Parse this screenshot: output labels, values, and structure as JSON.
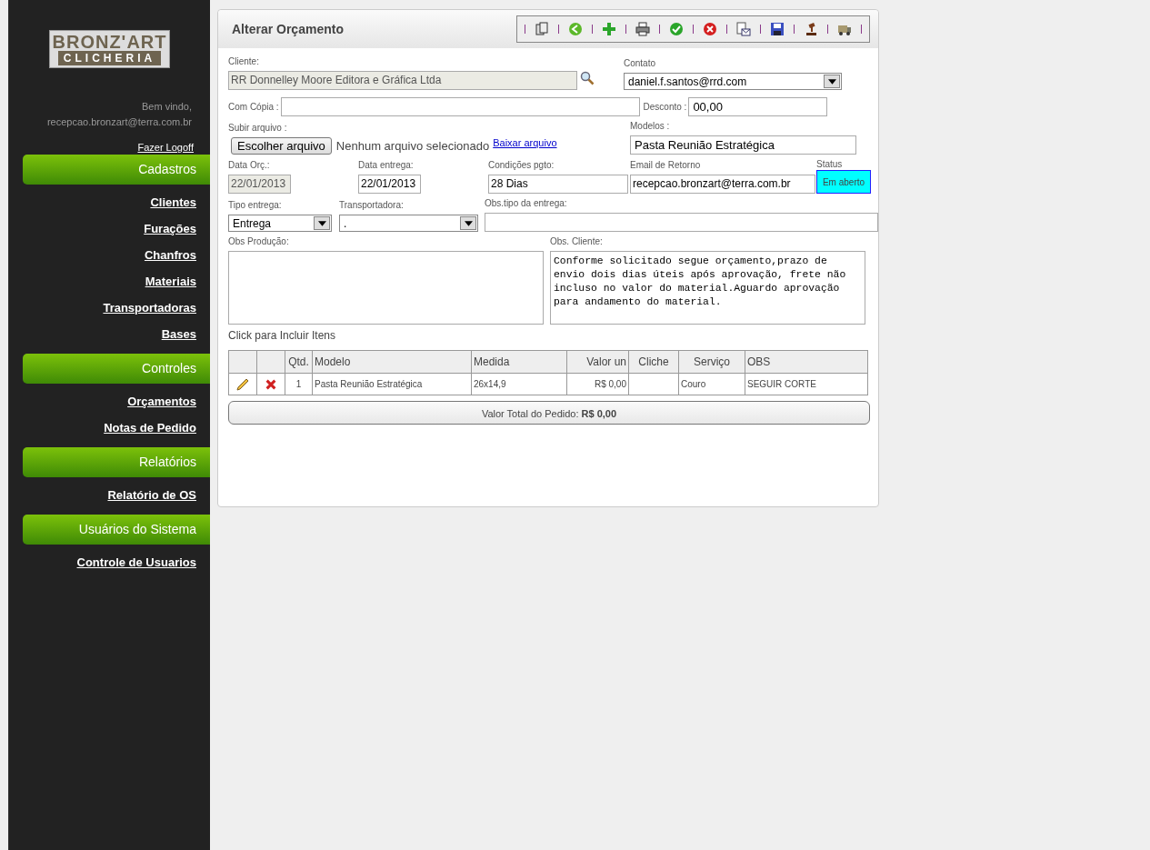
{
  "logo": {
    "line_1": "BRONZ'ART",
    "line_2": "CLICHERIA"
  },
  "welcome": {
    "greeting": "Bem vindo,",
    "user": "recepcao.bronzart@terra.com.br",
    "logoff": "Fazer Logoff"
  },
  "sidebar": [
    {
      "header": "Cadastros",
      "items": [
        "Clientes",
        "Furações",
        "Chanfros",
        "Materiais",
        "Transportadoras",
        "Bases"
      ]
    },
    {
      "header": "Controles",
      "items": [
        "Orçamentos",
        "Notas de Pedido"
      ]
    },
    {
      "header": "Relatórios",
      "items": [
        "Relatório de OS"
      ]
    },
    {
      "header": "Usuários do Sistema",
      "items": [
        "Controle de Usuarios"
      ]
    }
  ],
  "panel": {
    "title": "Alterar Orçamento"
  },
  "form": {
    "cliente": {
      "label": "Cliente:",
      "value": "RR Donnelley Moore Editora e Gráfica Ltda"
    },
    "contato": {
      "label": "Contato",
      "value": "daniel.f.santos@rrd.com"
    },
    "com_copia": {
      "label": "Com Cópia :"
    },
    "desconto": {
      "label": "Desconto :",
      "value": "00,00"
    },
    "subir_arquivo": {
      "label": "Subir arquivo :",
      "button": "Escolher arquivo",
      "status": "Nenhum arquivo selecionado",
      "link": "Baixar arquivo"
    },
    "modelos": {
      "label": "Modelos :",
      "value": "Pasta Reunião Estratégica"
    },
    "data_orc": {
      "label": "Data Orç.:",
      "value": "22/01/2013"
    },
    "data_entrega": {
      "label": "Data entrega:",
      "value": "22/01/2013"
    },
    "condicoes": {
      "label": "Condições pgto:",
      "value": "28 Dias"
    },
    "email_retorno": {
      "label": "Email de Retorno",
      "value": "recepcao.bronzart@terra.com.br"
    },
    "status": {
      "label": "Status",
      "value": "Em aberto"
    },
    "tipo_entrega": {
      "label": "Tipo entrega:",
      "value": "Entrega"
    },
    "transportadora": {
      "label": "Transportadora:",
      "value": "."
    },
    "obs_tipo": {
      "label": "Obs.tipo da entrega:"
    },
    "obs_producao": {
      "label": "Obs Produção:"
    },
    "obs_cliente": {
      "label": "Obs. Cliente:",
      "value": "Conforme solicitado segue orçamento,prazo de envio dois dias úteis após aprovação, frete não incluso no valor do material.Aguardo aprovação para andamento do material."
    }
  },
  "include_items": "Click para Incluir Itens",
  "table": {
    "columns": [
      "Qtd.",
      "Modelo",
      "Medida",
      "Valor un",
      "Cliche",
      "Serviço",
      "OBS"
    ],
    "rows": [
      {
        "cells": [
          "1",
          "Pasta Reunião Estratégica",
          "26x14,9",
          "R$ 0,00",
          "",
          "Couro",
          "SEGUIR CORTE"
        ]
      }
    ]
  },
  "total": "Valor Total do Pedido: **R$ 0,00**"
}
